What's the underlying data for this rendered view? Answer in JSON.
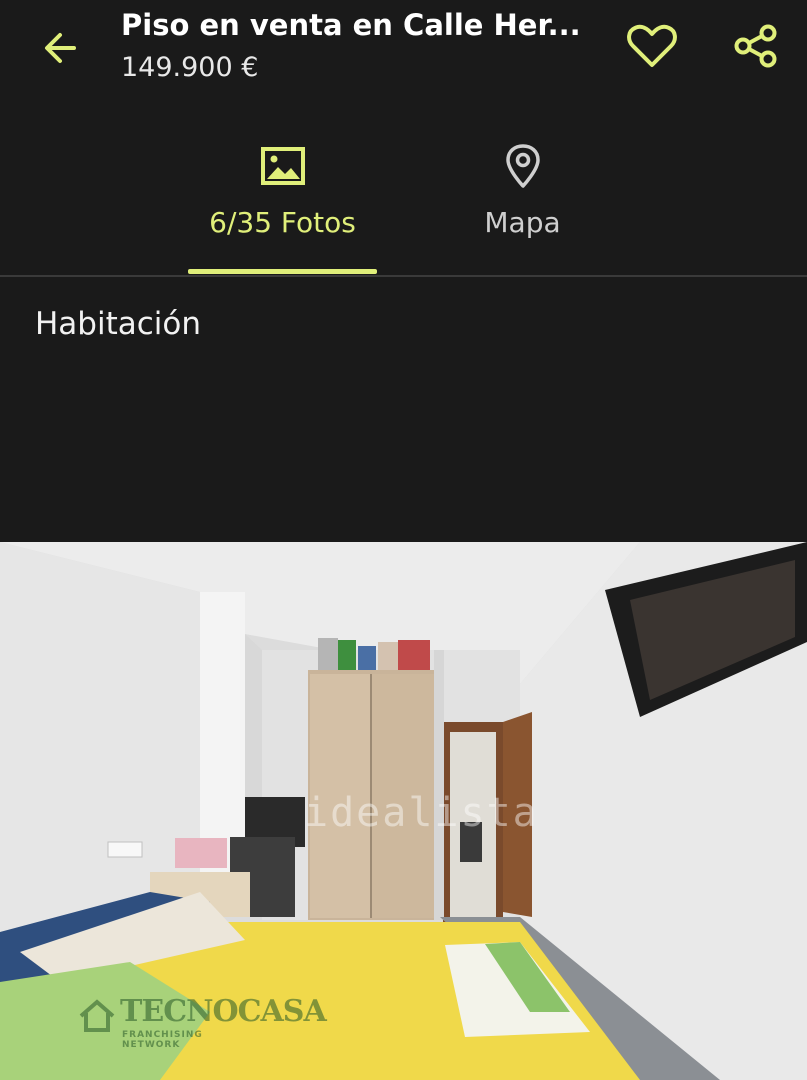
{
  "header": {
    "title": "Piso en venta en Calle Her...",
    "price": "149.900 €",
    "back_icon": "arrow-left-icon",
    "favorite_icon": "heart-icon",
    "share_icon": "share-icon"
  },
  "tabs": [
    {
      "label": "6/35 Fotos",
      "icon": "image-icon",
      "active": true
    },
    {
      "label": "Mapa",
      "icon": "map-pin-icon",
      "active": false
    }
  ],
  "caption": "Habitación",
  "photo": {
    "watermark": "idealista",
    "brand": "TECNOCASA",
    "brand_sub": "FRANCHISING NETWORK"
  },
  "colors": {
    "background": "#1a1a1a",
    "accent": "#e0ef7a",
    "text": "#f2f2f2",
    "muted": "#cfcfcf"
  }
}
